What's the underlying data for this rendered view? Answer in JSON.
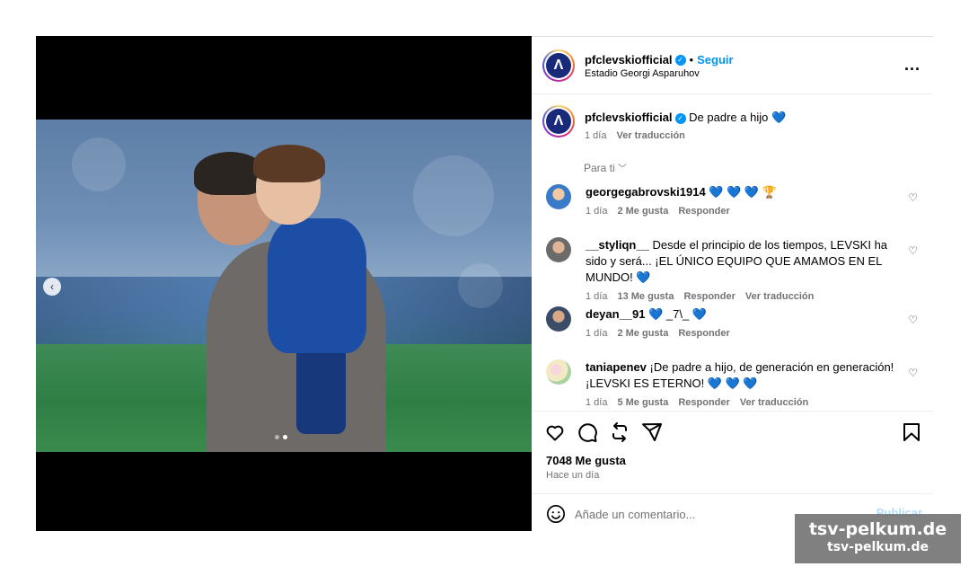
{
  "post": {
    "username": "pfclevskiofficial",
    "follow_label": "Seguir",
    "separator": "•",
    "location": "Estadio Georgi Asparuhov",
    "more_icon": "...",
    "avatar_letter": "Λ",
    "caption": {
      "username": "pfclevskiofficial",
      "text": "De padre a hijo 💙",
      "time": "1 día",
      "translate": "Ver traducción"
    },
    "for_you_label": "Para ti",
    "comments": [
      {
        "username": "georgegabrovski1914",
        "text": "💙 💙 💙 🏆",
        "time": "1 día",
        "likes": "2 Me gusta",
        "reply": "Responder",
        "translate": ""
      },
      {
        "username": "__styliqn__",
        "text": "Desde el principio de los tiempos, LEVSKI ha sido y será... ¡EL ÚNICO EQUIPO QUE AMAMOS EN EL MUNDO! 💙",
        "time": "1 día",
        "likes": "13 Me gusta",
        "reply": "Responder",
        "translate": "Ver traducción"
      },
      {
        "username": "deyan__91",
        "text": "💙 _7\\_ 💙",
        "time": "1 día",
        "likes": "2 Me gusta",
        "reply": "Responder",
        "translate": ""
      },
      {
        "username": "taniapenev",
        "text": "¡De padre a hijo, de generación en generación! ¡LEVSKI ES ETERNO! 💙 💙 💙",
        "time": "1 día",
        "likes": "5 Me gusta",
        "reply": "Responder",
        "translate": "Ver traducción"
      }
    ],
    "like_count": "7048 Me gusta",
    "posted_ago": "Hace un día",
    "comment_placeholder": "Añade un comentario...",
    "publish_label": "Publicar",
    "carousel": {
      "current": 2,
      "total": 2
    }
  },
  "icons": [
    "heart-icon",
    "comment-icon",
    "repost-icon",
    "share-icon",
    "bookmark-icon",
    "emoji-icon",
    "chevron-left-icon",
    "more-icon",
    "verified-icon"
  ],
  "colors": {
    "link_blue": "#0095f6",
    "publish_disabled": "#b2dffc",
    "levski_blue": "#1a2a7a",
    "meta_gray": "#737373"
  },
  "watermark": {
    "line1": "tsv-pelkum.de",
    "line2": "tsv-pelkum.de"
  }
}
